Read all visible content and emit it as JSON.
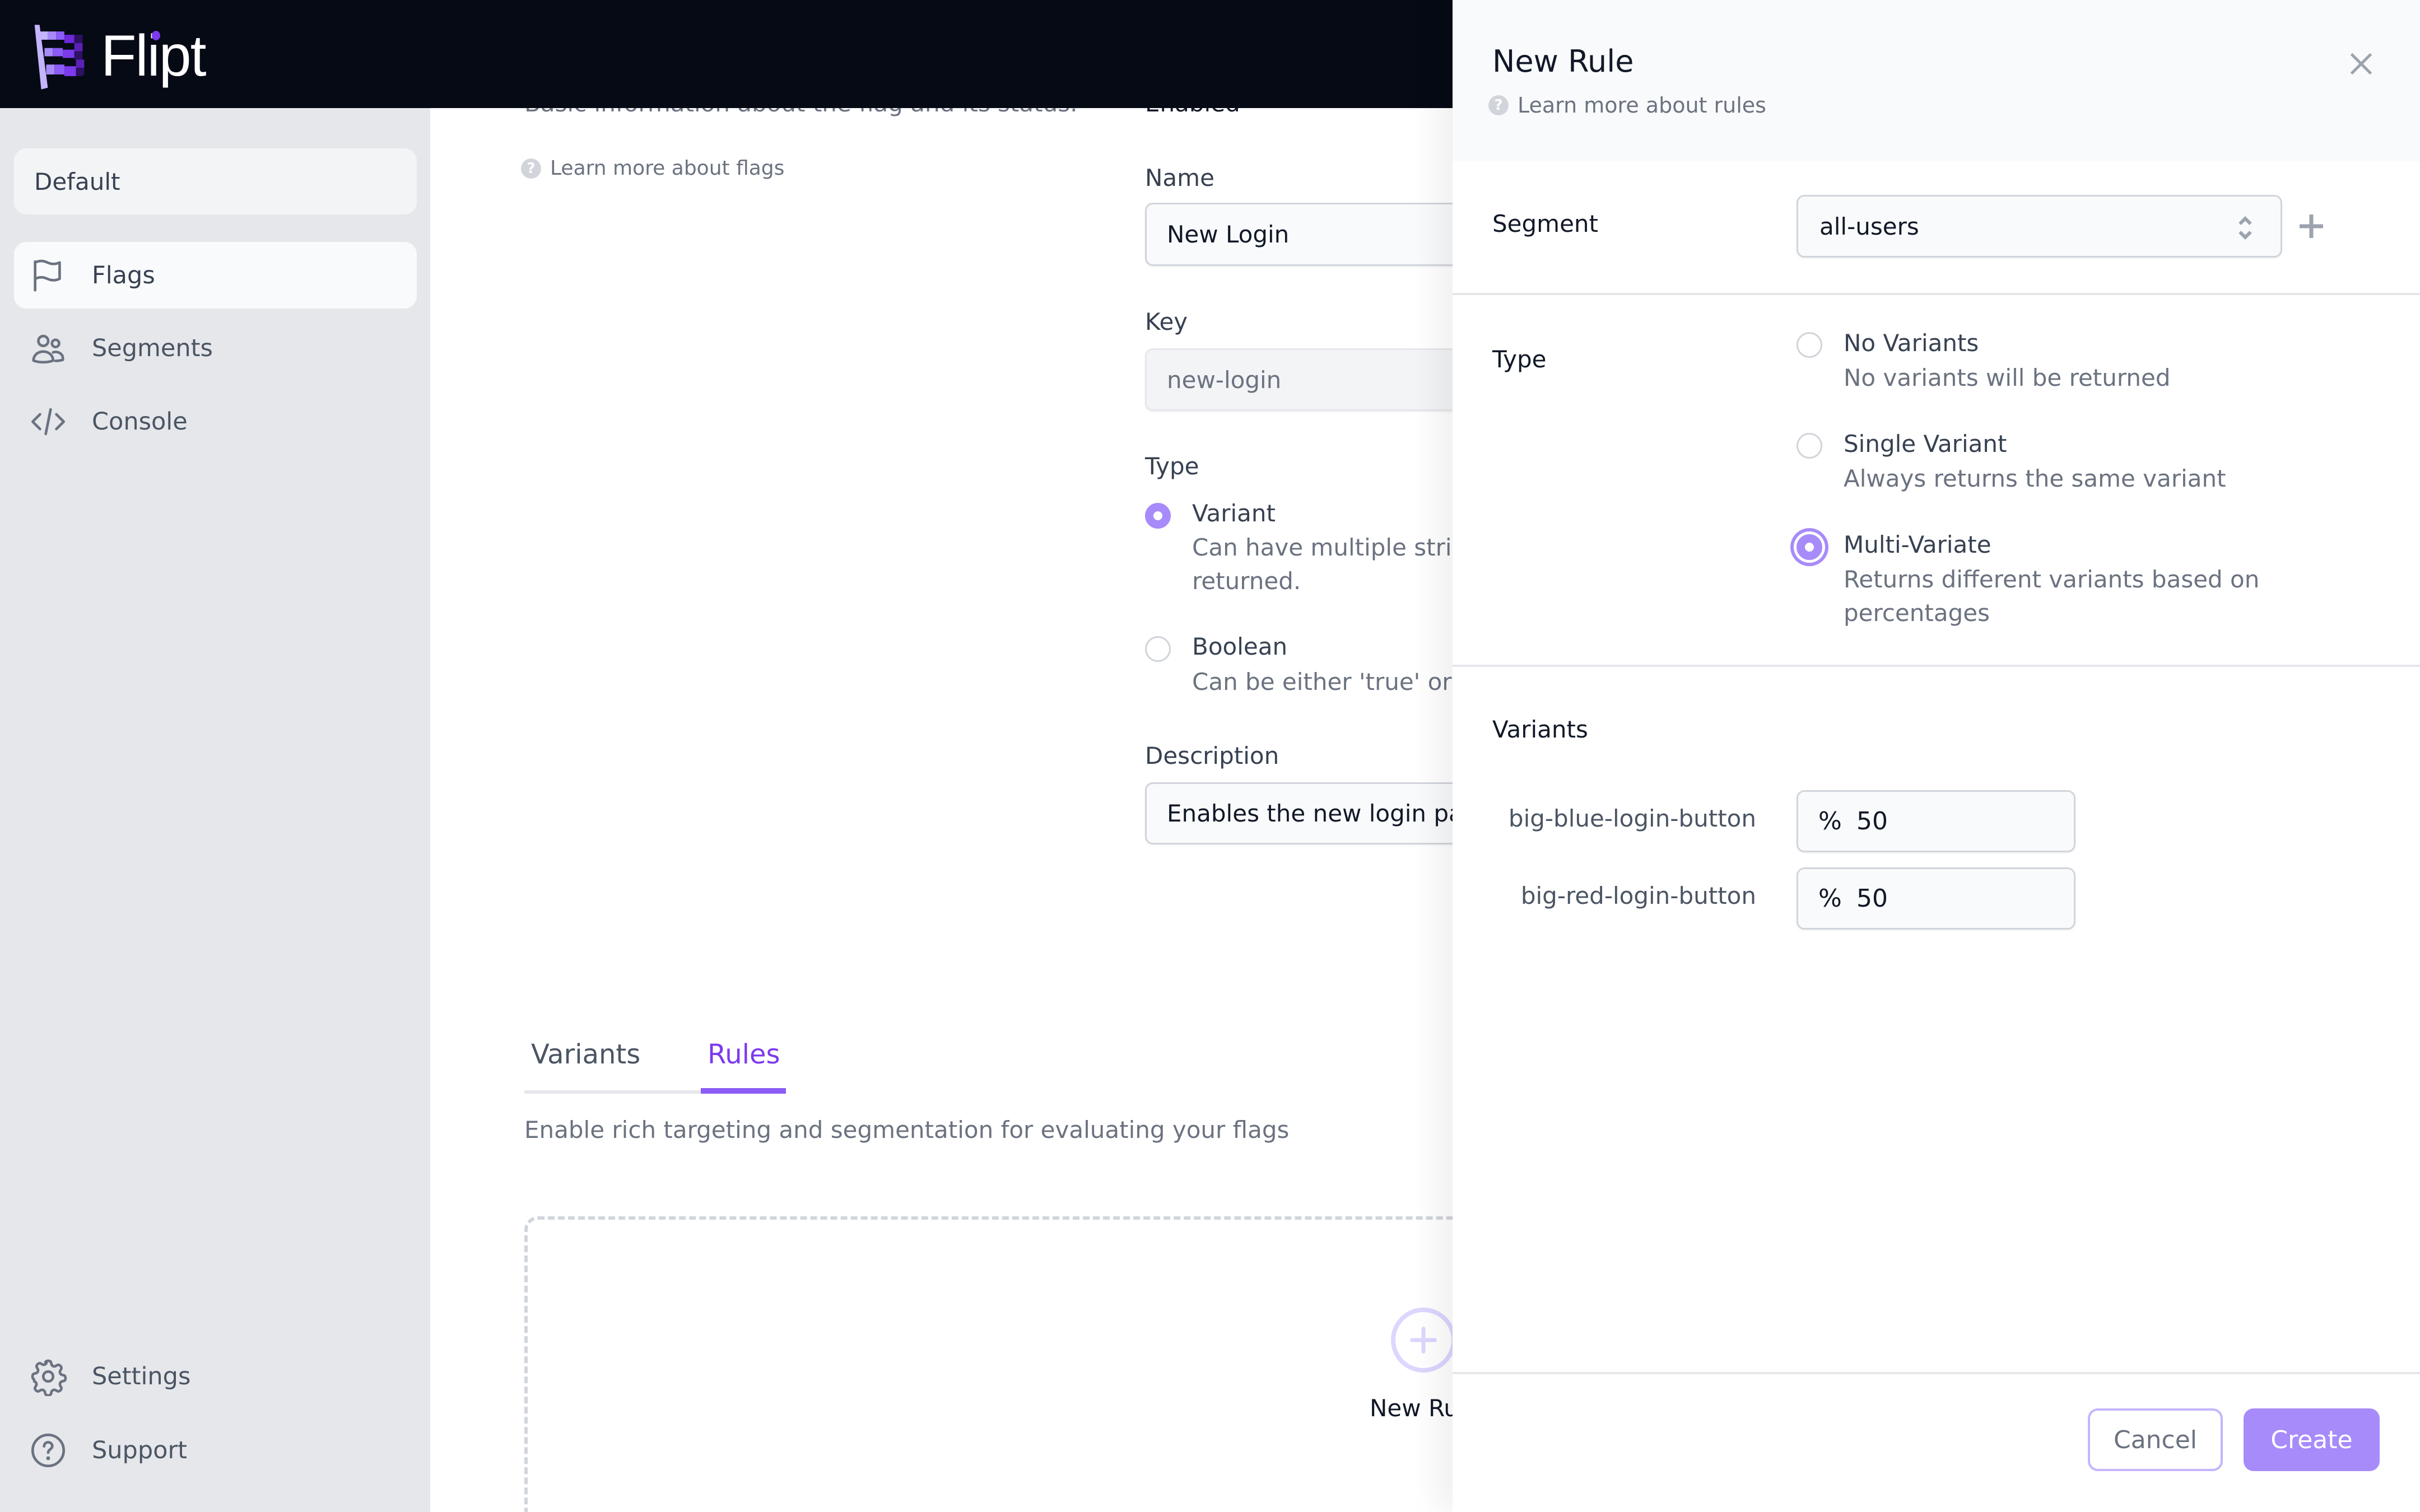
{
  "app": {
    "name": "Flipt",
    "accent_color": "#8b5cf6"
  },
  "sidebar": {
    "namespace": "Default",
    "items": [
      {
        "label": "Flags",
        "icon": "flag-icon",
        "active": true
      },
      {
        "label": "Segments",
        "icon": "users-icon",
        "active": false
      },
      {
        "label": "Console",
        "icon": "code-icon",
        "active": false
      }
    ],
    "footer_items": [
      {
        "label": "Settings",
        "icon": "gear-icon"
      },
      {
        "label": "Support",
        "icon": "question-circle-icon"
      }
    ]
  },
  "flag_form": {
    "section_description": "Basic information about the flag and its status.",
    "learn_more": "Learn more about flags",
    "enabled_label": "Enabled",
    "name_label": "Name",
    "name_value": "New Login",
    "key_label": "Key",
    "key_value": "new-login",
    "type_label": "Type",
    "type_options": [
      {
        "title": "Variant",
        "desc_line1": "Can have multiple stri",
        "desc_line2": "returned.",
        "checked": true
      },
      {
        "title": "Boolean",
        "desc_line1": "Can be either 'true' or",
        "checked": false
      }
    ],
    "description_label": "Description",
    "description_value": "Enables the new login pa"
  },
  "tabs": {
    "items": [
      {
        "label": "Variants",
        "active": false
      },
      {
        "label": "Rules",
        "active": true
      }
    ],
    "rules_description": "Enable rich targeting and segmentation for evaluating your flags",
    "empty_state_label": "New Ru"
  },
  "panel": {
    "title": "New Rule",
    "learn_more": "Learn more about rules",
    "segment_label": "Segment",
    "segment_value": "all-users",
    "type_label": "Type",
    "type_options": [
      {
        "title": "No Variants",
        "desc_line1": "No variants will be returned",
        "checked": false
      },
      {
        "title": "Single Variant",
        "desc_line1": "Always returns the same variant",
        "checked": false
      },
      {
        "title": "Multi-Variate",
        "desc_line1": "Returns different variants based on",
        "desc_line2": "percentages",
        "checked": true
      }
    ],
    "variants_label": "Variants",
    "variants": [
      {
        "key": "big-blue-login-button",
        "unit": "%",
        "percentage": "50"
      },
      {
        "key": "big-red-login-button",
        "unit": "%",
        "percentage": "50"
      }
    ],
    "cancel_label": "Cancel",
    "create_label": "Create"
  }
}
